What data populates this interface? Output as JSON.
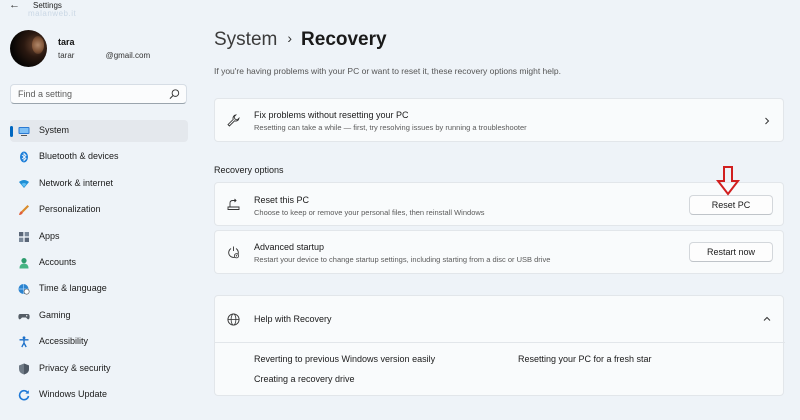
{
  "window": {
    "title": "Settings",
    "back_icon": "back-arrow-icon",
    "watermark": "malanweb.it"
  },
  "profile": {
    "name": "tara",
    "email": "tarar              @gmail.com"
  },
  "search": {
    "placeholder": "Find a setting",
    "icon": "search-icon"
  },
  "sidebar": {
    "items": [
      {
        "label": "System",
        "icon": "system-monitor-icon",
        "active": true
      },
      {
        "label": "Bluetooth & devices",
        "icon": "bluetooth-icon"
      },
      {
        "label": "Network & internet",
        "icon": "wifi-icon"
      },
      {
        "label": "Personalization",
        "icon": "paintbrush-icon"
      },
      {
        "label": "Apps",
        "icon": "apps-icon"
      },
      {
        "label": "Accounts",
        "icon": "accounts-icon"
      },
      {
        "label": "Time & language",
        "icon": "globe-clock-icon"
      },
      {
        "label": "Gaming",
        "icon": "gamepad-icon"
      },
      {
        "label": "Accessibility",
        "icon": "accessibility-icon"
      },
      {
        "label": "Privacy & security",
        "icon": "shield-icon"
      },
      {
        "label": "Windows Update",
        "icon": "update-icon"
      }
    ]
  },
  "main": {
    "breadcrumb": {
      "parent": "System",
      "separator": "›",
      "current": "Recovery"
    },
    "intro": "If you're having problems with your PC or want to reset it, these recovery options might help.",
    "fix_card": {
      "title": "Fix problems without resetting your PC",
      "description": "Resetting can take a while — first, try resolving issues by running a troubleshooter",
      "icon": "wrench-icon"
    },
    "section_label": "Recovery options",
    "reset_card": {
      "title": "Reset this PC",
      "description": "Choose to keep or remove your personal files, then reinstall Windows",
      "button": "Reset PC",
      "icon": "reset-drive-icon"
    },
    "advanced_card": {
      "title": "Advanced startup",
      "description": "Restart your device to change startup settings, including starting from a disc or USB drive",
      "button": "Restart now",
      "icon": "advanced-startup-icon"
    },
    "help_card": {
      "title": "Help with Recovery",
      "icon": "globe-icon",
      "links": [
        "Reverting to previous Windows version easily",
        "Resetting your PC for a fresh star",
        "Creating a recovery drive"
      ]
    }
  },
  "colors": {
    "accent": "#0067c0",
    "annotation_arrow": "#d11f1f",
    "background": "#eef3f8",
    "card": "#f9fbfc"
  }
}
